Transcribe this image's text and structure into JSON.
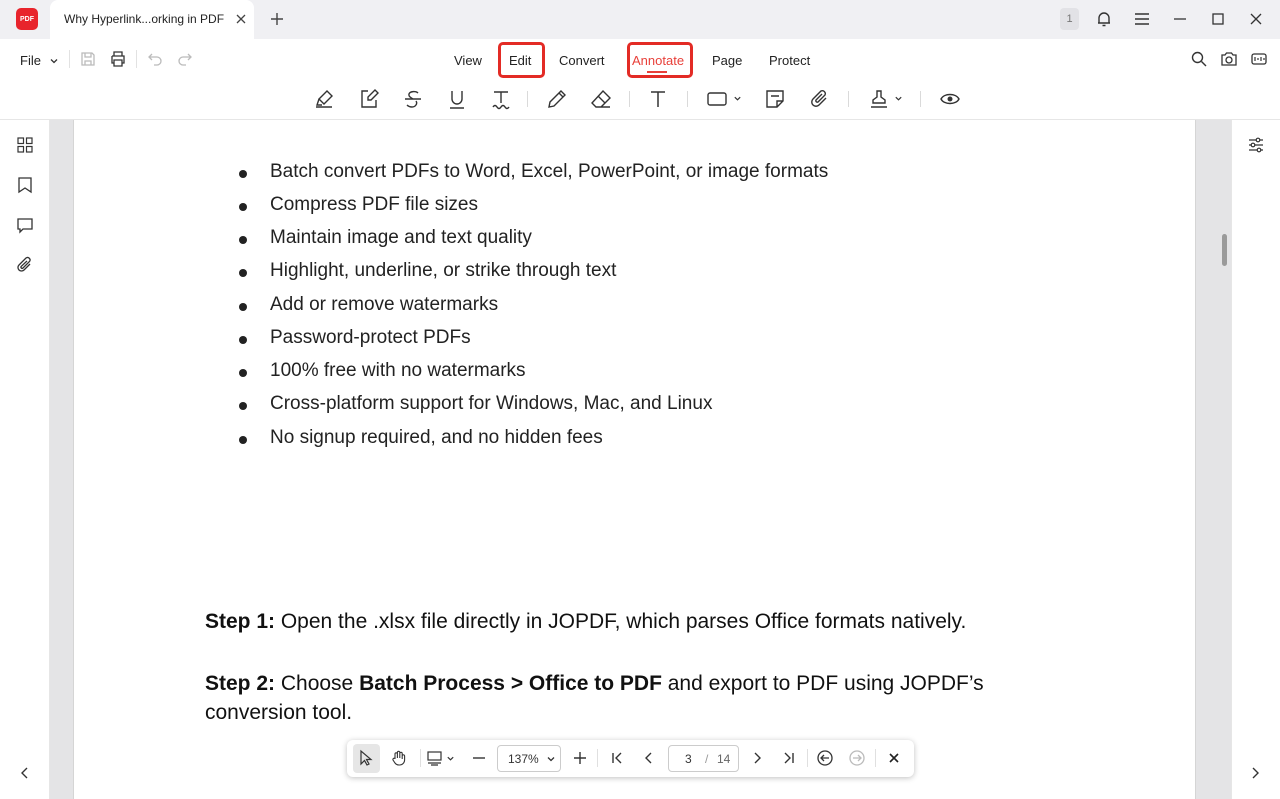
{
  "window": {
    "app_logo_text": "PDF",
    "tab_title": "Why Hyperlink...orking in PDF",
    "notification_count": "1"
  },
  "menubar": {
    "file_label": "File",
    "tabs": [
      {
        "label": "View"
      },
      {
        "label": "Edit"
      },
      {
        "label": "Convert"
      },
      {
        "label": "Annotate",
        "active": true
      },
      {
        "label": "Page"
      },
      {
        "label": "Protect"
      }
    ]
  },
  "toolbar": {
    "tools": [
      "highlight-icon",
      "area-highlight-icon",
      "strikethrough-icon",
      "underline-icon",
      "squiggly-icon",
      "pencil-icon",
      "eraser-icon",
      "text-box-icon",
      "shape-icon",
      "sticky-note-icon",
      "attachment-icon",
      "stamp-icon",
      "eye-icon"
    ]
  },
  "document": {
    "bullets": [
      "Batch convert PDFs to Word, Excel, PowerPoint, or image formats",
      "Compress PDF file sizes",
      "Maintain image and text quality",
      "Highlight, underline, or strike through text",
      "Add or remove watermarks",
      "Password-protect PDFs",
      "100% free with no watermarks",
      "Cross-platform support for Windows, Mac, and Linux",
      "No signup required, and no hidden fees"
    ],
    "step1": {
      "label": "Step 1:",
      "text": " Open the .xlsx file directly in JOPDF, which parses Office formats natively."
    },
    "step2": {
      "label": "Step 2:",
      "text_a": " Choose ",
      "bold": "Batch Process > Office to PDF",
      "text_b": " and export to PDF using JOPDF’s conversion tool."
    }
  },
  "navbar": {
    "zoom": "137%",
    "current_page": "3",
    "separator": "/",
    "total_pages": "14"
  },
  "colors": {
    "accent": "#e8403a",
    "highlight_box": "#e32b25",
    "brand": "#e8242c"
  }
}
